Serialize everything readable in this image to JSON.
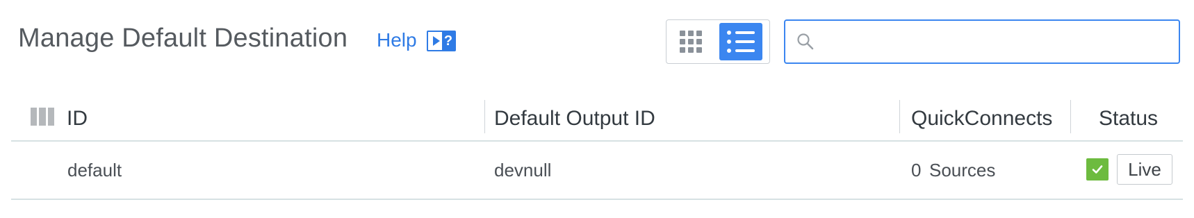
{
  "header": {
    "title": "Manage Default Destination",
    "help_label": "Help",
    "help_icon_label": "?"
  },
  "view_toggle": {
    "options": [
      "grid-view",
      "list-view"
    ],
    "selected": "list-view",
    "active_color": "#3b86f0"
  },
  "search": {
    "placeholder": "",
    "value": "",
    "icon": "search-icon"
  },
  "table": {
    "columns_icon": "columns-icon",
    "headers": {
      "id": "ID",
      "default_output_id": "Default Output ID",
      "quickconnects": "QuickConnects",
      "status": "Status"
    },
    "rows": [
      {
        "id": "default",
        "default_output_id": "devnull",
        "quickconnects_count": "0",
        "quickconnects_unit": "Sources",
        "status_checked": true,
        "status_label": "Live"
      }
    ]
  },
  "colors": {
    "link": "#2f7be5",
    "status_ok": "#6dbb3f"
  }
}
